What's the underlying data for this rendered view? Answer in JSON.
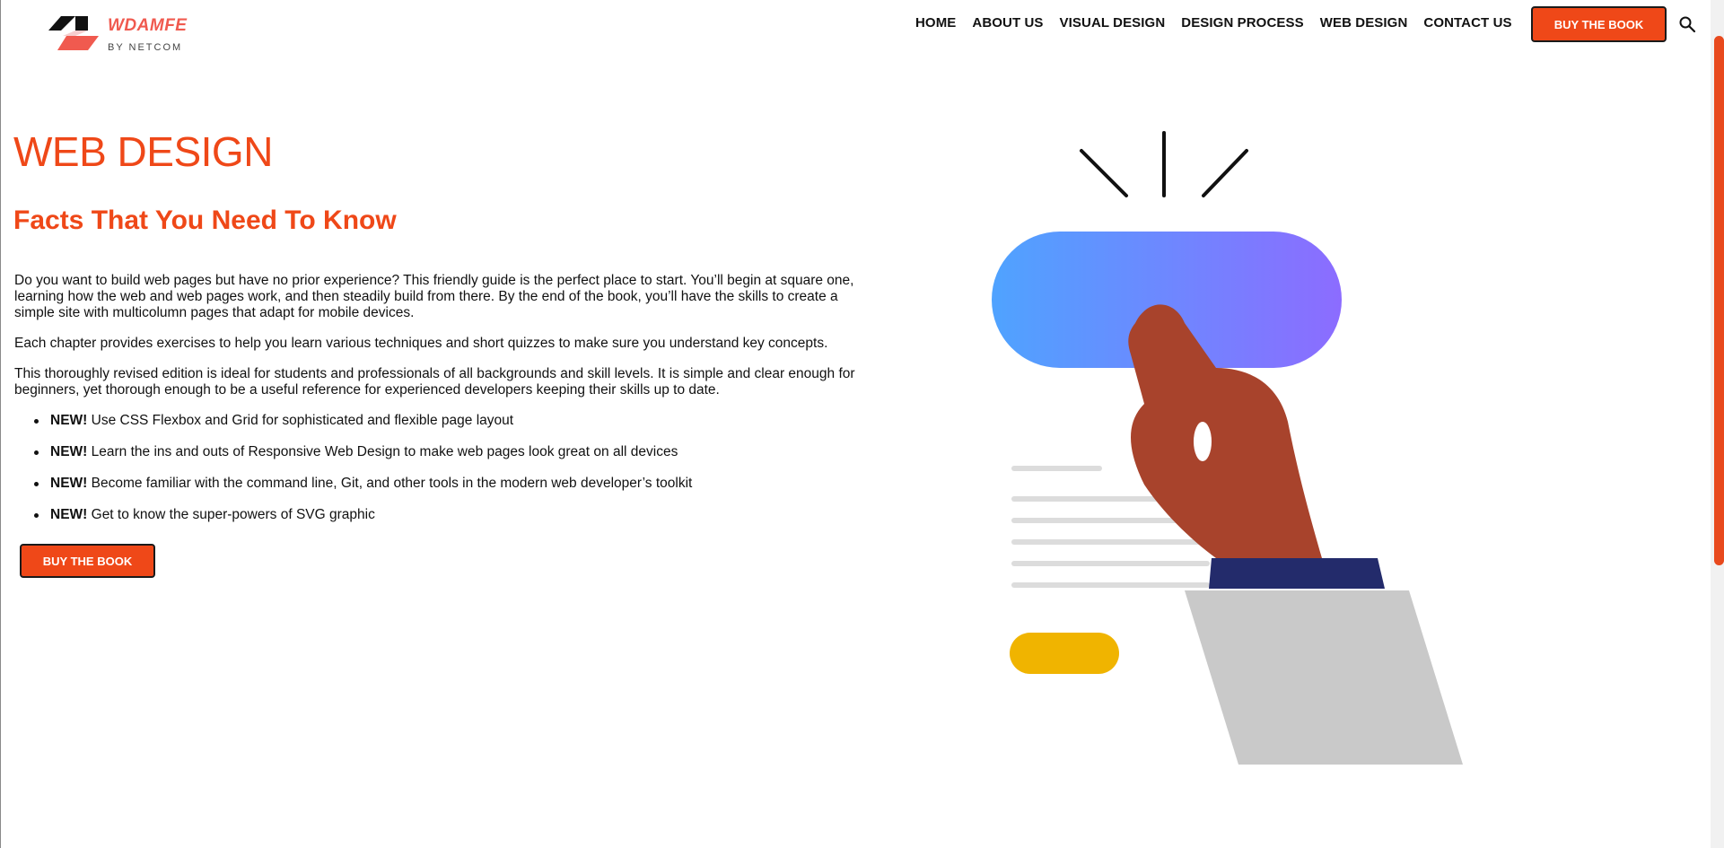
{
  "header": {
    "logo": {
      "title": "WDAMFE",
      "subtitle": "BY NETCOM"
    },
    "nav": [
      {
        "label": "HOME"
      },
      {
        "label": "ABOUT US"
      },
      {
        "label": "VISUAL DESIGN"
      },
      {
        "label": "DESIGN PROCESS"
      },
      {
        "label": "WEB DESIGN"
      },
      {
        "label": "CONTACT US"
      }
    ],
    "cta_label": "BUY THE BOOK",
    "search_icon": "search-icon"
  },
  "main": {
    "title": "WEB DESIGN",
    "subtitle": "Facts That You Need To Know",
    "paragraphs": [
      "Do you want to build web pages but have no prior experience? This friendly guide is the perfect place to start. You’ll begin at square one, learning how the web and web pages work, and then steadily build from there. By the end of the book, you’ll have the skills to create a simple site with multicolumn pages that adapt for mobile devices.",
      "Each chapter provides exercises to help you learn various techniques and short quizzes to make sure you understand key concepts.",
      "This thoroughly revised edition is ideal for students and professionals of all backgrounds and skill levels. It is simple and clear enough for beginners, yet thorough enough to be a useful reference for experienced developers keeping their skills up to date."
    ],
    "bullets": [
      {
        "tag": "NEW!",
        "text": " Use CSS Flexbox and Grid for sophisticated and flexible page layout"
      },
      {
        "tag": "NEW!",
        "text": " Learn the ins and outs of Responsive Web Design to make web pages look great on all devices"
      },
      {
        "tag": "NEW!",
        "text": " Become familiar with the command line, Git, and other tools in the modern web developer’s toolkit"
      },
      {
        "tag": "NEW!",
        "text": " Get to know the super-powers of SVG graphic"
      }
    ],
    "cta_label": "BUY THE BOOK"
  },
  "colors": {
    "accent": "#ef4818",
    "logo_red": "#f05a4f",
    "button_gradient_start": "#4fa3ff",
    "button_gradient_end": "#8c6cff",
    "hand": "#a8432c",
    "cuff": "#232b6b",
    "sleeve": "#c9c9c9",
    "yellow_pill": "#f0b400"
  }
}
